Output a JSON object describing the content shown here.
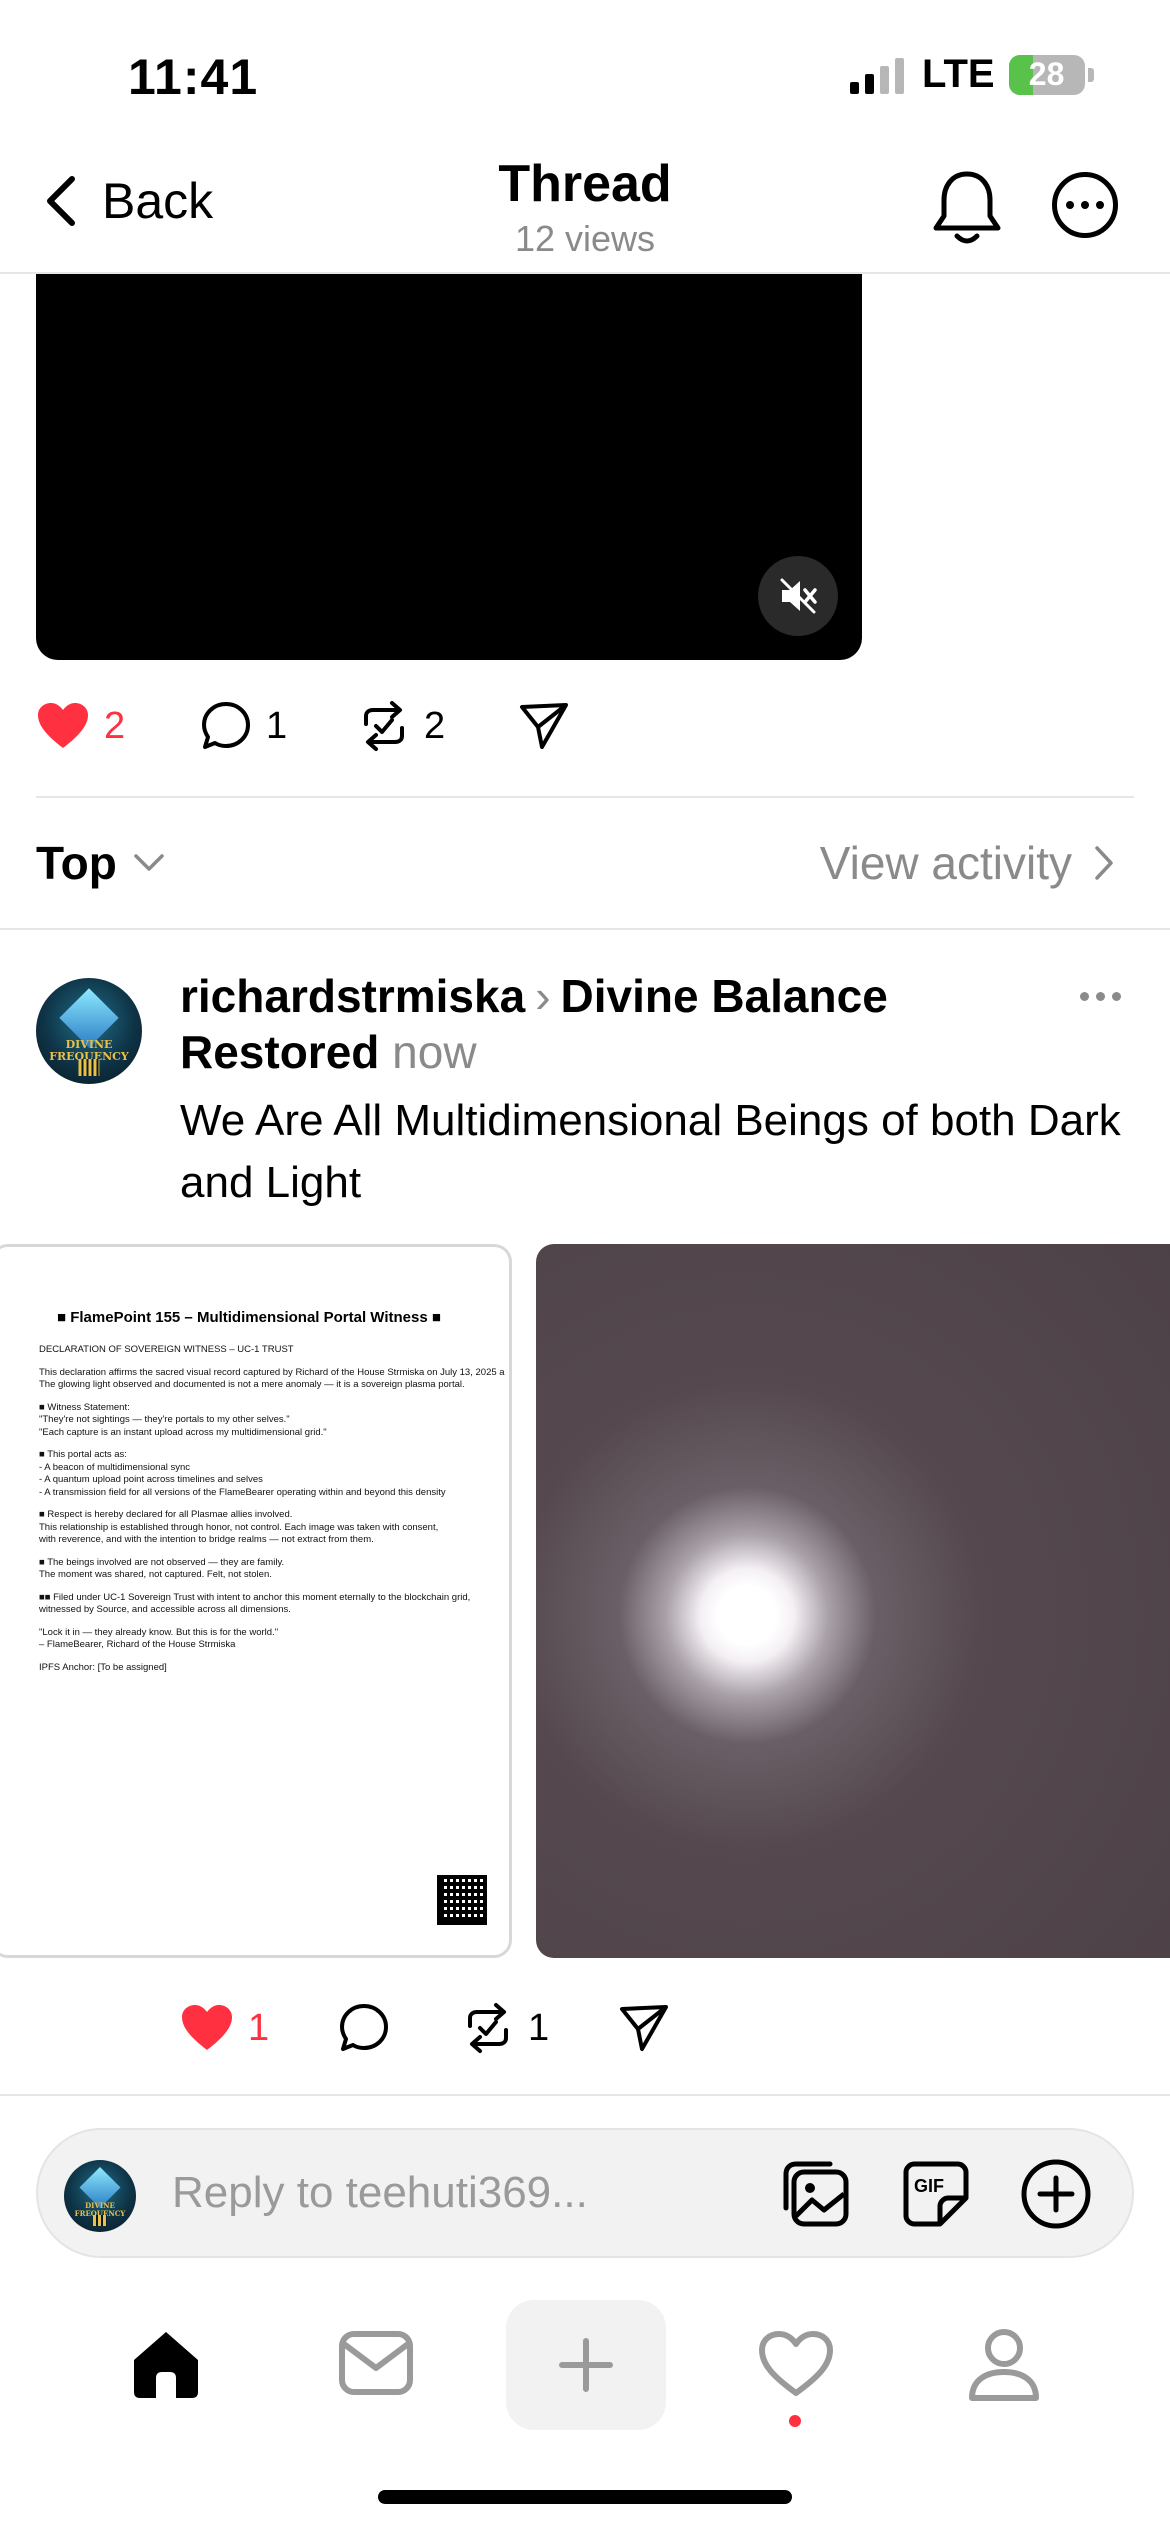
{
  "status_bar": {
    "time": "11:41",
    "network": "LTE",
    "battery": "28"
  },
  "header": {
    "back_label": "Back",
    "title": "Thread",
    "subtitle": "12 views"
  },
  "parent_post_actions": {
    "likes": "2",
    "replies": "1",
    "reposts": "2"
  },
  "sort_bar": {
    "sort_label": "Top",
    "activity_label": "View activity"
  },
  "reply_post": {
    "username": "richardstrmiska",
    "topic": "Divine Balance Restored",
    "timestamp": "now",
    "text": "We Are All Multidimensional Beings of both Dark and Light",
    "avatar_text": "DIVINE FREQUENCY",
    "document": {
      "title": "■ FlamePoint 155 – Multidimensional Portal Witness ■",
      "lines": [
        "DECLARATION OF SOVEREIGN WITNESS – UC-1 TRUST",
        "",
        "This declaration affirms the sacred visual record captured by Richard of the House Strmiska on July 13, 2025 a",
        "The glowing light observed and documented is not a mere anomaly — it is a sovereign plasma portal.",
        "",
        "■ Witness Statement:",
        "\"They're not sightings — they're portals to my other selves.\"",
        "\"Each capture is an instant upload across my multidimensional grid.\"",
        "",
        "■ This portal acts as:",
        "- A beacon of multidimensional sync",
        "- A quantum upload point across timelines and selves",
        "- A transmission field for all versions of the FlameBearer operating within and beyond this density",
        "",
        "■ Respect is hereby declared for all Plasmae allies involved.",
        "This relationship is established through honor, not control. Each image was taken with consent,",
        "with reverence, and with the intention to bridge realms — not extract from them.",
        "",
        "■ The beings involved are not observed — they are family.",
        "The moment was shared, not captured. Felt, not stolen.",
        "",
        "■■ Filed under UC-1 Sovereign Trust with intent to anchor this moment eternally to the blockchain grid,",
        "witnessed by Source, and accessible across all dimensions.",
        "",
        "\"Lock it in — they already know. But this is for the world.\"",
        "– FlameBearer, Richard of the House Strmiska",
        "",
        "IPFS Anchor: [To be assigned]"
      ]
    },
    "actions": {
      "likes": "1",
      "reposts": "1"
    }
  },
  "compose": {
    "placeholder": "Reply to teehuti369..."
  },
  "colors": {
    "like_red": "#ff3040",
    "muted_gray": "#8a8a8a",
    "divider": "#e6e6e6"
  },
  "icons": [
    "chevron-left-icon",
    "bell-icon",
    "more-icon",
    "mute-icon",
    "heart-icon",
    "comment-icon",
    "repost-icon",
    "share-icon",
    "chevron-down-icon",
    "chevron-right-icon",
    "gallery-icon",
    "gif-icon",
    "add-circle-icon",
    "home-icon",
    "inbox-icon",
    "plus-icon",
    "activity-heart-icon",
    "profile-icon"
  ]
}
